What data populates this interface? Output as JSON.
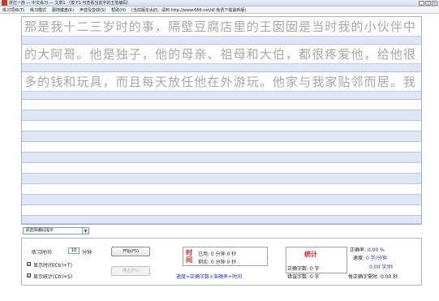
{
  "window": {
    "title": "拼打一族 — 中文练习 — 文章1 （按 F1 可查看当前字的五笔编码）",
    "controls": [
      "_",
      "□",
      "×"
    ]
  },
  "menu": [
    "练习项目(T)",
    "练习模式",
    "跟随键盘(K)",
    "声音及音效(S)",
    "帮助(H)",
    "(当前版本太旧，请到 http://www.666.net/dl 免费下载最新版)"
  ],
  "practice": {
    "lines": [
      "那是我十二三岁时的事，隔壁豆腐店里的王囡囡是当时我的小伙伴中",
      "的大阿哥。他是独子，他的母亲、祖母和大伯，都很疼爱他，给他很",
      "多的钱和玩具，而且每天放任他在外游玩。他家与我家贴邻而居。我"
    ]
  },
  "hint": {
    "value": "请选择编码提示",
    "arrow": "▼"
  },
  "controls": {
    "practice_time_label": "练习时间:",
    "practice_time_value": "10",
    "minutes_label": "分钟",
    "show_time_label": "显示时间(Ctrl+T)",
    "show_stats_label": "显示统计(Ctrl+S)",
    "checkbox_mark": "☑",
    "start_button": "开始(F5)",
    "stop_button": "停止(F5)"
  },
  "time": {
    "title": "时间",
    "elapsed": "已用: 0 分钟 0 秒",
    "remaining": "剩余: 0 分钟 0 秒"
  },
  "formula": "速度=正确字数×准确率÷时间",
  "stats": {
    "title": "统计",
    "correct_count": "正确字数: 0 字",
    "error_count": "错误字数: 0 字",
    "accuracy_label": "正确率:",
    "accuracy_value": "0.00 %",
    "speed_label": "速度:",
    "speed_per_min": "0 字/分钟",
    "speed_per_sec": "0.00 字/秒",
    "per_char_label": "每正确字需时:",
    "per_char_value": "0.00 秒"
  },
  "colors": {
    "accent_red": "#cc2020",
    "value_blue": "#2233cc",
    "row_blue": "#dfe7f7"
  }
}
